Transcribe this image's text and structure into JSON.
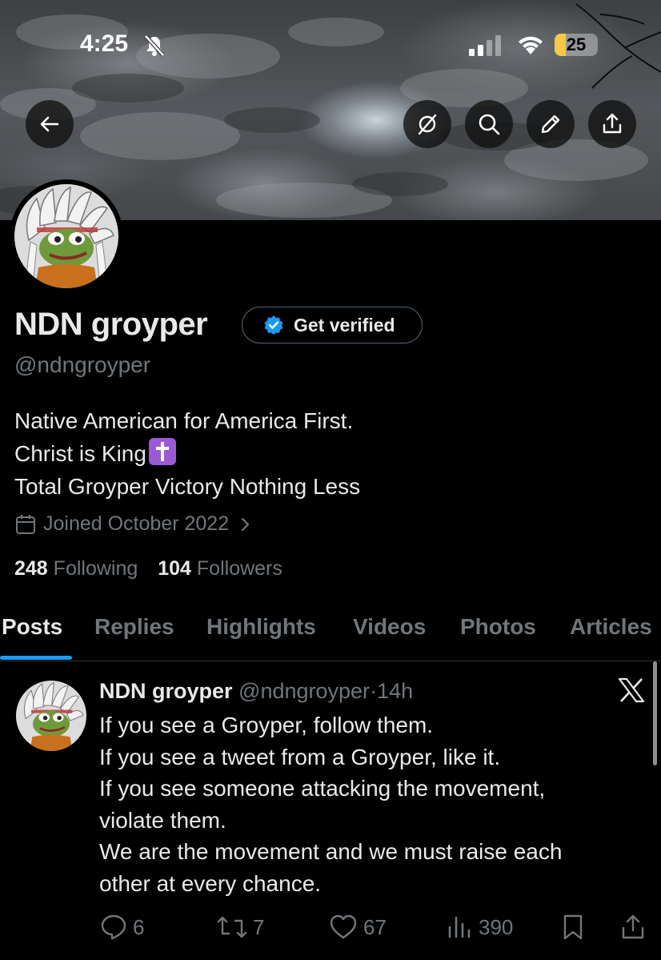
{
  "status_bar": {
    "time": "4:25",
    "battery_level": "25",
    "battery_fraction": 0.25
  },
  "header_actions": {
    "back_icon": "arrow-left-icon",
    "grok_icon": "slash-circle-icon",
    "search_icon": "search-icon",
    "edit_icon": "pencil-icon",
    "share_icon": "share-icon"
  },
  "profile": {
    "display_name": "NDN groyper",
    "get_verified_label": "Get verified",
    "handle": "@ndngroyper",
    "bio_lines": [
      "Native American for America First.",
      "Christ is King",
      "Total Groyper Victory Nothing Less"
    ],
    "joined": "Joined October 2022",
    "following_count": "248",
    "following_label": "Following",
    "followers_count": "104",
    "followers_label": "Followers"
  },
  "tabs": [
    {
      "label": "Posts",
      "active": true
    },
    {
      "label": "Replies",
      "active": false
    },
    {
      "label": "Highlights",
      "active": false
    },
    {
      "label": "Videos",
      "active": false
    },
    {
      "label": "Photos",
      "active": false
    },
    {
      "label": "Articles",
      "active": false
    }
  ],
  "post": {
    "author_name": "NDN groyper",
    "author_handle": "@ndngroyper",
    "separator": "·",
    "time": "14h",
    "lines": [
      "If you see a Groyper, follow them.",
      "If you see a tweet from a Groyper, like it.",
      "If you see someone attacking the movement,",
      "violate them.",
      "We are the movement and we must raise each",
      "other at every chance."
    ],
    "replies": "6",
    "reposts": "7",
    "likes": "67",
    "views": "390"
  },
  "colors": {
    "accent": "#1d9bf0",
    "muted": "#71767b",
    "text": "#e7e9ea",
    "background": "#000000",
    "battery": "#f5c945"
  }
}
